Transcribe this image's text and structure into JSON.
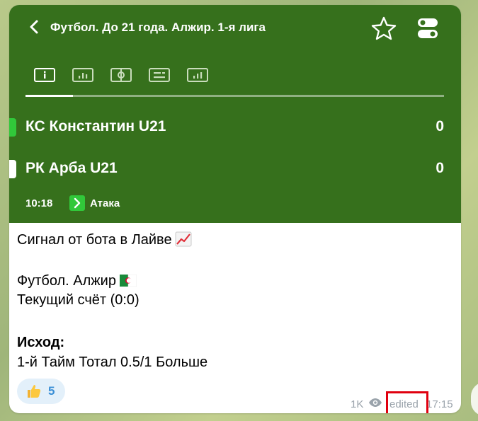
{
  "header": {
    "title": "Футбол. До 21 года. Алжир. 1-я лига",
    "icons": [
      "back-chevron-icon",
      "star-icon",
      "toggle-settings-icon"
    ]
  },
  "tabs": [
    {
      "icon": "info-icon",
      "active": true
    },
    {
      "icon": "stats-chart-icon",
      "active": false
    },
    {
      "icon": "field-icon",
      "active": false
    },
    {
      "icon": "lineup-icon",
      "active": false
    },
    {
      "icon": "bar-stats-icon",
      "active": false
    }
  ],
  "match": {
    "team1": {
      "name": "КС Константин U21",
      "score": "0",
      "marker_color": "#31c83a"
    },
    "team2": {
      "name": "РК Арба U21",
      "score": "0",
      "marker_color": "#ffffff"
    },
    "time": "10:18",
    "status": "Атака"
  },
  "message": {
    "line1": "Сигнал от бота в Лайве",
    "line2": "Футбол. Алжир",
    "line3": "Текущий счёт (0:0)",
    "line4": "Исход:",
    "line5": "1-й Тайм Тотал 0.5/1 Больше"
  },
  "reaction": {
    "emoji": "thumbs-up-icon",
    "count": "5"
  },
  "footer": {
    "views": "1K",
    "edited": "edited",
    "time": "17:15"
  },
  "colors": {
    "header_bg": "#36701c",
    "accent_blue": "#3a8fd6",
    "highlight": "#e0000f"
  }
}
